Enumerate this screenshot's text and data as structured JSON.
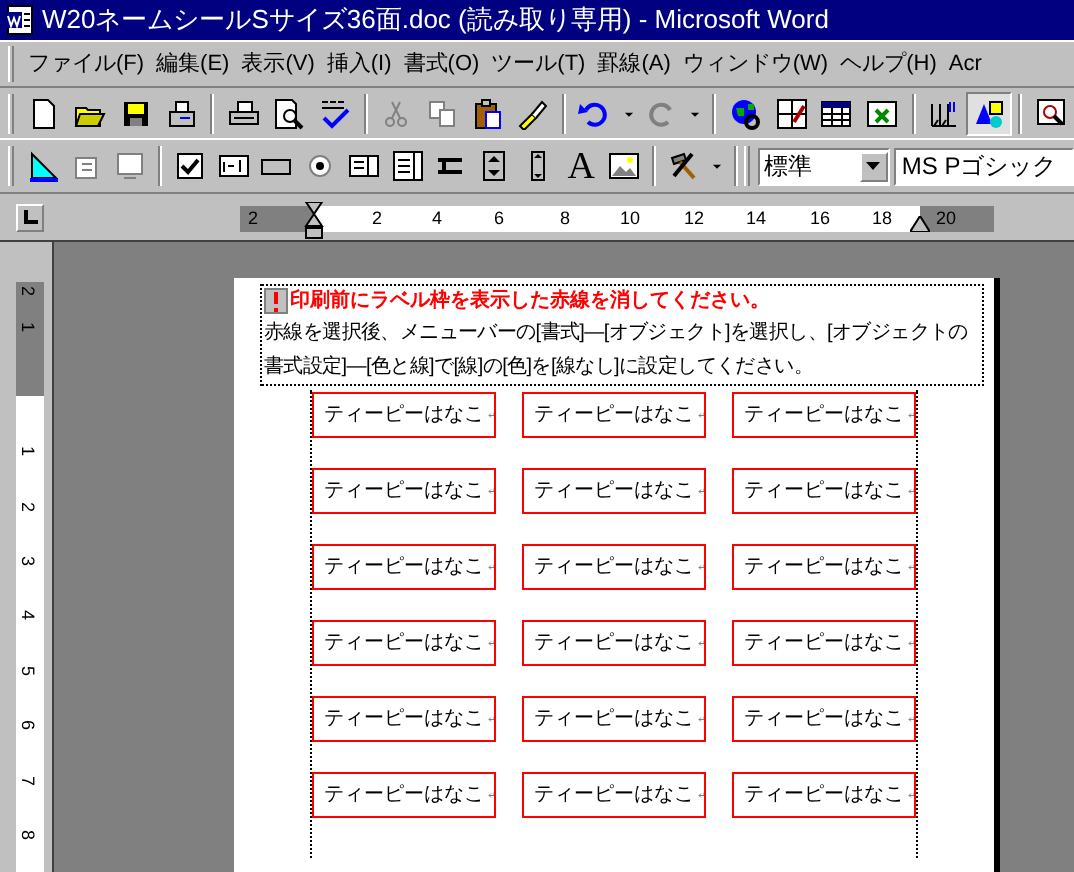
{
  "window": {
    "title": "W20ネームシールSサイズ36面.doc (読み取り専用) - Microsoft Word"
  },
  "menu": [
    "ファイル(F)",
    "編集(E)",
    "表示(V)",
    "挿入(I)",
    "書式(O)",
    "ツール(T)",
    "罫線(A)",
    "ウィンドウ(W)",
    "ヘルプ(H)",
    "Acr"
  ],
  "toolbar": {
    "label_tool": "A",
    "style_box": "標準",
    "font_box": "MS Pゴシック"
  },
  "ruler": {
    "horizontal": [
      "2",
      "2",
      "4",
      "6",
      "8",
      "10",
      "12",
      "14",
      "16",
      "18",
      "20"
    ],
    "vertical": [
      "2",
      "1",
      "1",
      "2",
      "3",
      "4",
      "5",
      "6",
      "7",
      "8"
    ]
  },
  "document": {
    "warning": "印刷前にラベル枠を表示した赤線を消してください。",
    "instruction": "赤線を選択後、メニューバーの[書式]—[オブジェクト]を選択し、[オブジェクトの書式設定]—[色と線]で[線]の[色]を[線なし]に設定してください。",
    "labels": [
      [
        "ティーピーはなこ",
        "ティーピーはなこ",
        "ティーピーはなこ"
      ],
      [
        "ティーピーはなこ",
        "ティーピーはなこ",
        "ティーピーはなこ"
      ],
      [
        "ティーピーはなこ",
        "ティーピーはなこ",
        "ティーピーはなこ"
      ],
      [
        "ティーピーはなこ",
        "ティーピーはなこ",
        "ティーピーはなこ"
      ],
      [
        "ティーピーはなこ",
        "ティーピーはなこ",
        "ティーピーはなこ"
      ],
      [
        "ティーピーはなこ",
        "ティーピーはなこ",
        "ティーピーはなこ"
      ]
    ]
  }
}
